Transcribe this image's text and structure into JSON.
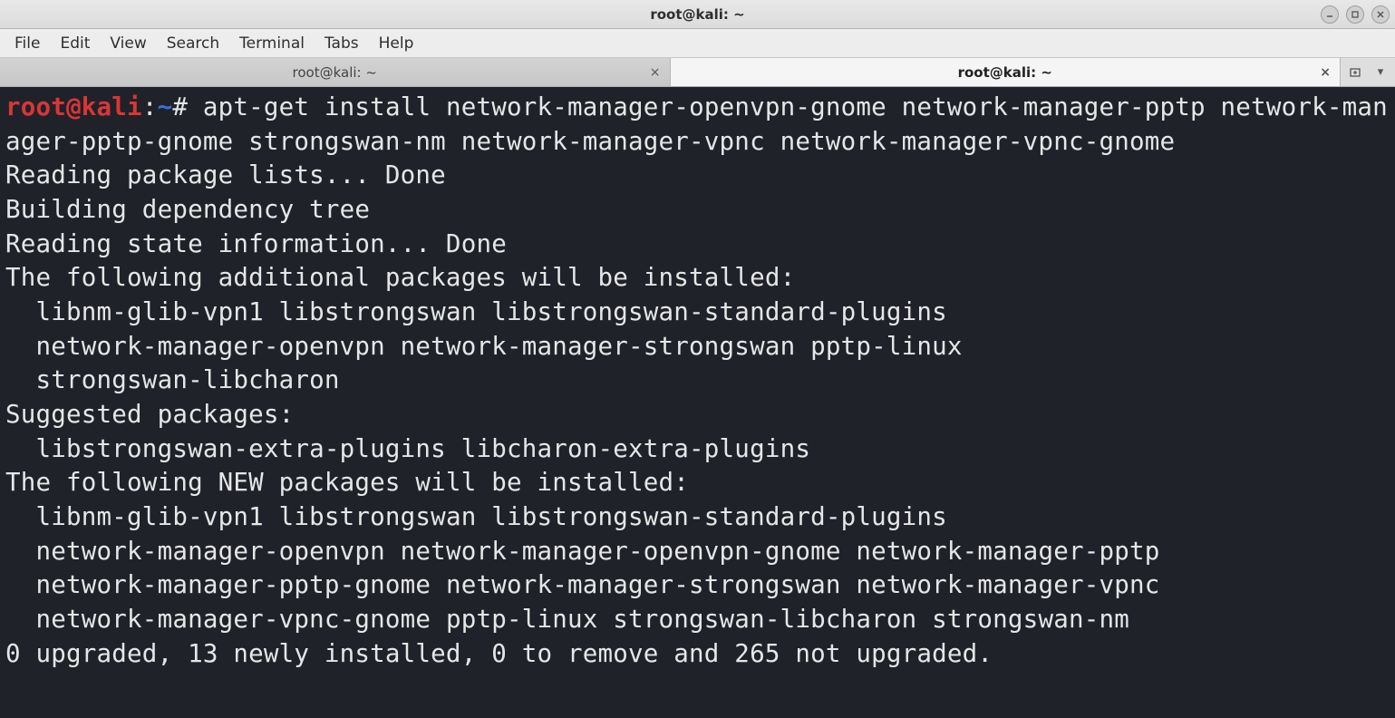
{
  "window": {
    "title": "root@kali: ~"
  },
  "menu": {
    "items": [
      "File",
      "Edit",
      "View",
      "Search",
      "Terminal",
      "Tabs",
      "Help"
    ]
  },
  "tabs": {
    "list": [
      {
        "label": "root@kali: ~",
        "active": false
      },
      {
        "label": "root@kali: ~",
        "active": true
      }
    ]
  },
  "prompt": {
    "user": "root@kali",
    "sep1": ":",
    "path": "~",
    "sep2": "#"
  },
  "command": " apt-get install network-manager-openvpn-gnome network-manager-pptp network-manager-pptp-gnome strongswan-nm network-manager-vpnc network-manager-vpnc-gnome",
  "output_lines": [
    "Reading package lists... Done",
    "Building dependency tree",
    "Reading state information... Done",
    "The following additional packages will be installed:",
    "  libnm-glib-vpn1 libstrongswan libstrongswan-standard-plugins",
    "  network-manager-openvpn network-manager-strongswan pptp-linux",
    "  strongswan-libcharon",
    "Suggested packages:",
    "  libstrongswan-extra-plugins libcharon-extra-plugins",
    "The following NEW packages will be installed:",
    "  libnm-glib-vpn1 libstrongswan libstrongswan-standard-plugins",
    "  network-manager-openvpn network-manager-openvpn-gnome network-manager-pptp",
    "  network-manager-pptp-gnome network-manager-strongswan network-manager-vpnc",
    "  network-manager-vpnc-gnome pptp-linux strongswan-libcharon strongswan-nm",
    "0 upgraded, 13 newly installed, 0 to remove and 265 not upgraded."
  ]
}
